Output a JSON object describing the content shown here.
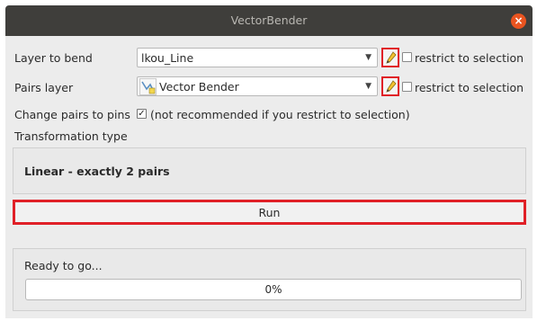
{
  "window": {
    "title": "VectorBender"
  },
  "rows": {
    "layer_to_bend": {
      "label": "Layer to bend",
      "value": "lkou_Line",
      "restrict_label": "restrict to selection",
      "restrict_checked": false
    },
    "pairs_layer": {
      "label": "Pairs layer",
      "value": "Vector Bender",
      "restrict_label": "restrict to selection",
      "restrict_checked": false
    },
    "change_pairs": {
      "label": "Change pairs to pins",
      "checked": true,
      "note": "(not recommended if you restrict to selection)"
    }
  },
  "transformation": {
    "label": "Transformation type",
    "value": "Linear - exactly 2 pairs"
  },
  "run": {
    "label": "Run"
  },
  "status": {
    "text": "Ready to go...",
    "progress_text": "0%",
    "progress_value": 0
  },
  "icons": {
    "edit": "pencil-icon",
    "layer": "line-layer-icon",
    "close": "close-icon"
  },
  "colors": {
    "accent": "#e95420",
    "highlight": "#e02027",
    "titlebar": "#3f3e3b"
  }
}
